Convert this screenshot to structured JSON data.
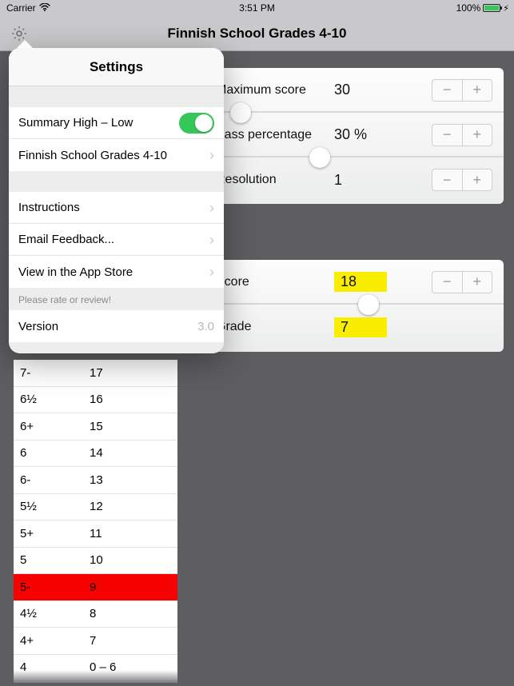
{
  "status": {
    "carrier": "Carrier",
    "wifi": "▾",
    "time": "3:51 PM",
    "battery_pct": "100%"
  },
  "nav": {
    "title": "Finnish School Grades 4-10"
  },
  "card1": {
    "r0": {
      "label": "Maximum score",
      "value": "30"
    },
    "r1": {
      "label": "Pass percentage",
      "value": "30 %"
    },
    "r2": {
      "label": "Resolution",
      "value": "1"
    }
  },
  "card2": {
    "r0": {
      "label": "Score",
      "value": "18"
    },
    "r1": {
      "label": "Grade",
      "value": "7"
    }
  },
  "grades": [
    {
      "grade": "7-",
      "score": "17",
      "red": false
    },
    {
      "grade": "6½",
      "score": "16",
      "red": false
    },
    {
      "grade": "6+",
      "score": "15",
      "red": false
    },
    {
      "grade": "6",
      "score": "14",
      "red": false
    },
    {
      "grade": "6-",
      "score": "13",
      "red": false
    },
    {
      "grade": "5½",
      "score": "12",
      "red": false
    },
    {
      "grade": "5+",
      "score": "11",
      "red": false
    },
    {
      "grade": "5",
      "score": "10",
      "red": false
    },
    {
      "grade": "5-",
      "score": "9",
      "red": true
    },
    {
      "grade": "4½",
      "score": "8",
      "red": false
    },
    {
      "grade": "4+",
      "score": "7",
      "red": false
    },
    {
      "grade": "4",
      "score": "0   –   6",
      "red": false
    }
  ],
  "popover": {
    "title": "Settings",
    "summary_label": "Summary High – Low",
    "system_label": "Finnish School Grades 4-10",
    "instructions": "Instructions",
    "feedback": "Email Feedback...",
    "appstore": "View in the App Store",
    "rate_hint": "Please rate or review!",
    "version_label": "Version",
    "version_value": "3.0"
  }
}
